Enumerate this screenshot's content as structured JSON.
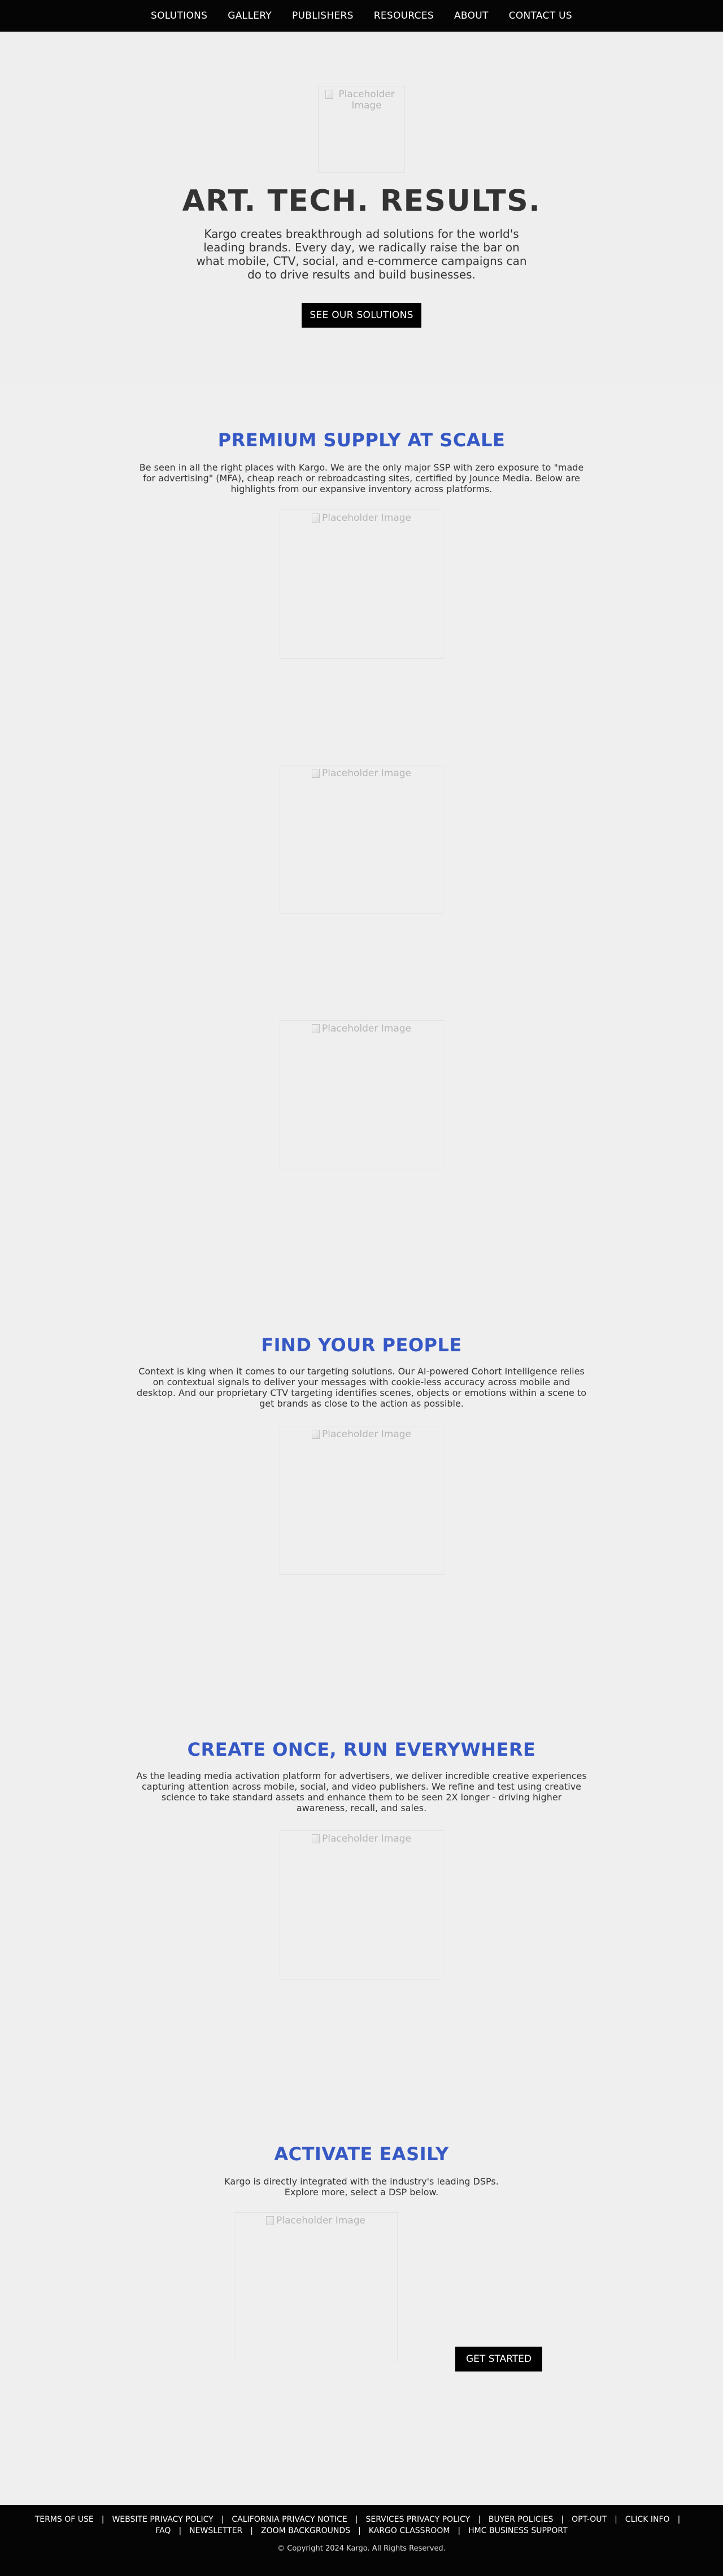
{
  "nav": {
    "items": [
      "SOLUTIONS",
      "GALLERY",
      "PUBLISHERS",
      "RESOURCES",
      "ABOUT",
      "CONTACT US"
    ]
  },
  "placeholder": "Placeholder Image",
  "hero": {
    "title": "ART. TECH. RESULTS.",
    "text": "Kargo creates breakthrough ad solutions for the world's leading brands. Every day, we radically raise the bar on what mobile, CTV, social, and e-commerce campaigns can do to drive results and build businesses.",
    "button": "SEE OUR SOLUTIONS"
  },
  "sections": [
    {
      "title": "PREMIUM SUPPLY AT SCALE",
      "text": "Be seen in all the right places with Kargo. We are the only major SSP with zero exposure to \"made for advertising\" (MFA), cheap reach or rebroadcasting sites, certified by Jounce Media. Below are highlights from our expansive inventory across platforms."
    },
    {
      "title": "FIND YOUR PEOPLE",
      "text": "Context is king when it comes to our targeting solutions. Our AI-powered Cohort Intelligence relies on contextual signals to deliver your messages with cookie-less accuracy across mobile and desktop. And our proprietary CTV targeting identifies scenes, objects or emotions within a scene to get brands as close to the action as possible."
    },
    {
      "title": "CREATE ONCE, RUN EVERYWHERE",
      "text": "As the leading media activation platform for advertisers, we deliver incredible creative experiences capturing attention across mobile, social, and video publishers. We refine and test using creative science to take standard assets and enhance them to be seen 2X longer - driving higher awareness, recall, and sales."
    },
    {
      "title": "ACTIVATE EASILY",
      "text": "Kargo is directly integrated with the industry's leading DSPs. Explore more, select a DSP below.",
      "button": "GET STARTED"
    }
  ],
  "footer": {
    "links_row1": [
      "TERMS OF USE",
      "WEBSITE PRIVACY POLICY",
      "CALIFORNIA PRIVACY NOTICE",
      "SERVICES PRIVACY POLICY",
      "BUYER POLICIES",
      "OPT-OUT",
      "CLICK INFO"
    ],
    "links_row2": [
      "FAQ",
      "NEWSLETTER",
      "ZOOM BACKGROUNDS",
      "KARGO CLASSROOM",
      "HMC BUSINESS SUPPORT"
    ],
    "separator": "|",
    "copyright": "© Copyright 2024 Kargo. All Rights Reserved."
  }
}
